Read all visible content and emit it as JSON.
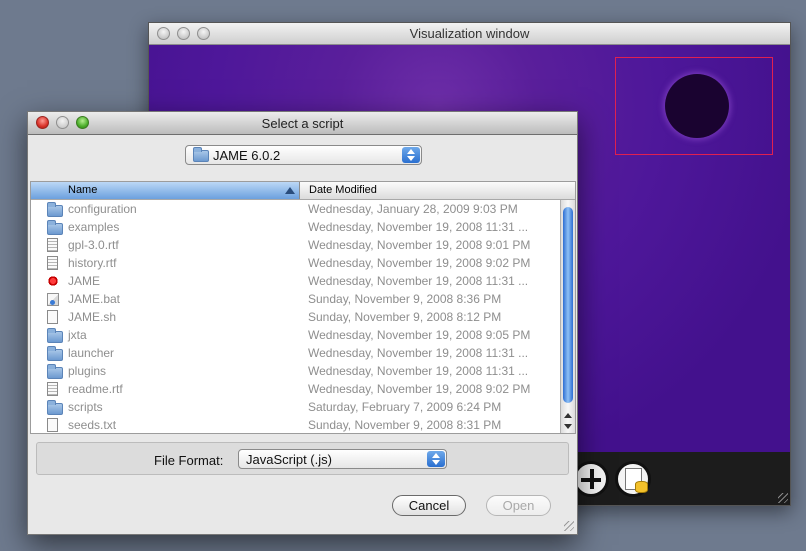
{
  "viz_window": {
    "title": "Visualization window",
    "toolbar_icons": [
      "add-icon",
      "document-database-icon"
    ]
  },
  "dialog": {
    "title": "Select a script",
    "folder_popup": {
      "value": "JAME 6.0.2",
      "icon": "folder-icon"
    },
    "columns": {
      "name": "Name",
      "date": "Date Modified",
      "sort": "ascending"
    },
    "files": [
      {
        "name": "configuration",
        "date": "Wednesday, January 28, 2009 9:03 PM",
        "icon": "folder-icon"
      },
      {
        "name": "examples",
        "date": "Wednesday, November 19, 2008 11:31 ...",
        "icon": "folder-icon"
      },
      {
        "name": "gpl-3.0.rtf",
        "date": "Wednesday, November 19, 2008 9:01 PM",
        "icon": "rtf-document-icon"
      },
      {
        "name": "history.rtf",
        "date": "Wednesday, November 19, 2008 9:02 PM",
        "icon": "rtf-document-icon"
      },
      {
        "name": "JAME",
        "date": "Wednesday, November 19, 2008 11:31 ...",
        "icon": "application-icon"
      },
      {
        "name": "JAME.bat",
        "date": "Sunday, November 9, 2008 8:36 PM",
        "icon": "batch-file-icon"
      },
      {
        "name": "JAME.sh",
        "date": "Sunday, November 9, 2008 8:12 PM",
        "icon": "text-document-icon"
      },
      {
        "name": "jxta",
        "date": "Wednesday, November 19, 2008 9:05 PM",
        "icon": "folder-icon"
      },
      {
        "name": "launcher",
        "date": "Wednesday, November 19, 2008 11:31 ...",
        "icon": "folder-icon"
      },
      {
        "name": "plugins",
        "date": "Wednesday, November 19, 2008 11:31 ...",
        "icon": "folder-icon"
      },
      {
        "name": "readme.rtf",
        "date": "Wednesday, November 19, 2008 9:02 PM",
        "icon": "rtf-document-icon"
      },
      {
        "name": "scripts",
        "date": "Saturday, February 7, 2009 6:24 PM",
        "icon": "folder-icon"
      },
      {
        "name": "seeds.txt",
        "date": "Sunday, November 9, 2008 8:31 PM",
        "icon": "text-document-icon"
      }
    ],
    "file_format": {
      "label": "File Format:",
      "value": "JavaScript (.js)"
    },
    "buttons": {
      "cancel": "Cancel",
      "open": "Open"
    }
  },
  "colors": {
    "desktop": "#6e7a8e",
    "viz_background": "#4a1690",
    "accent_blue": "#2a6fd0",
    "selection_box": "#e02050",
    "disabled_text": "#8e8e8e"
  }
}
